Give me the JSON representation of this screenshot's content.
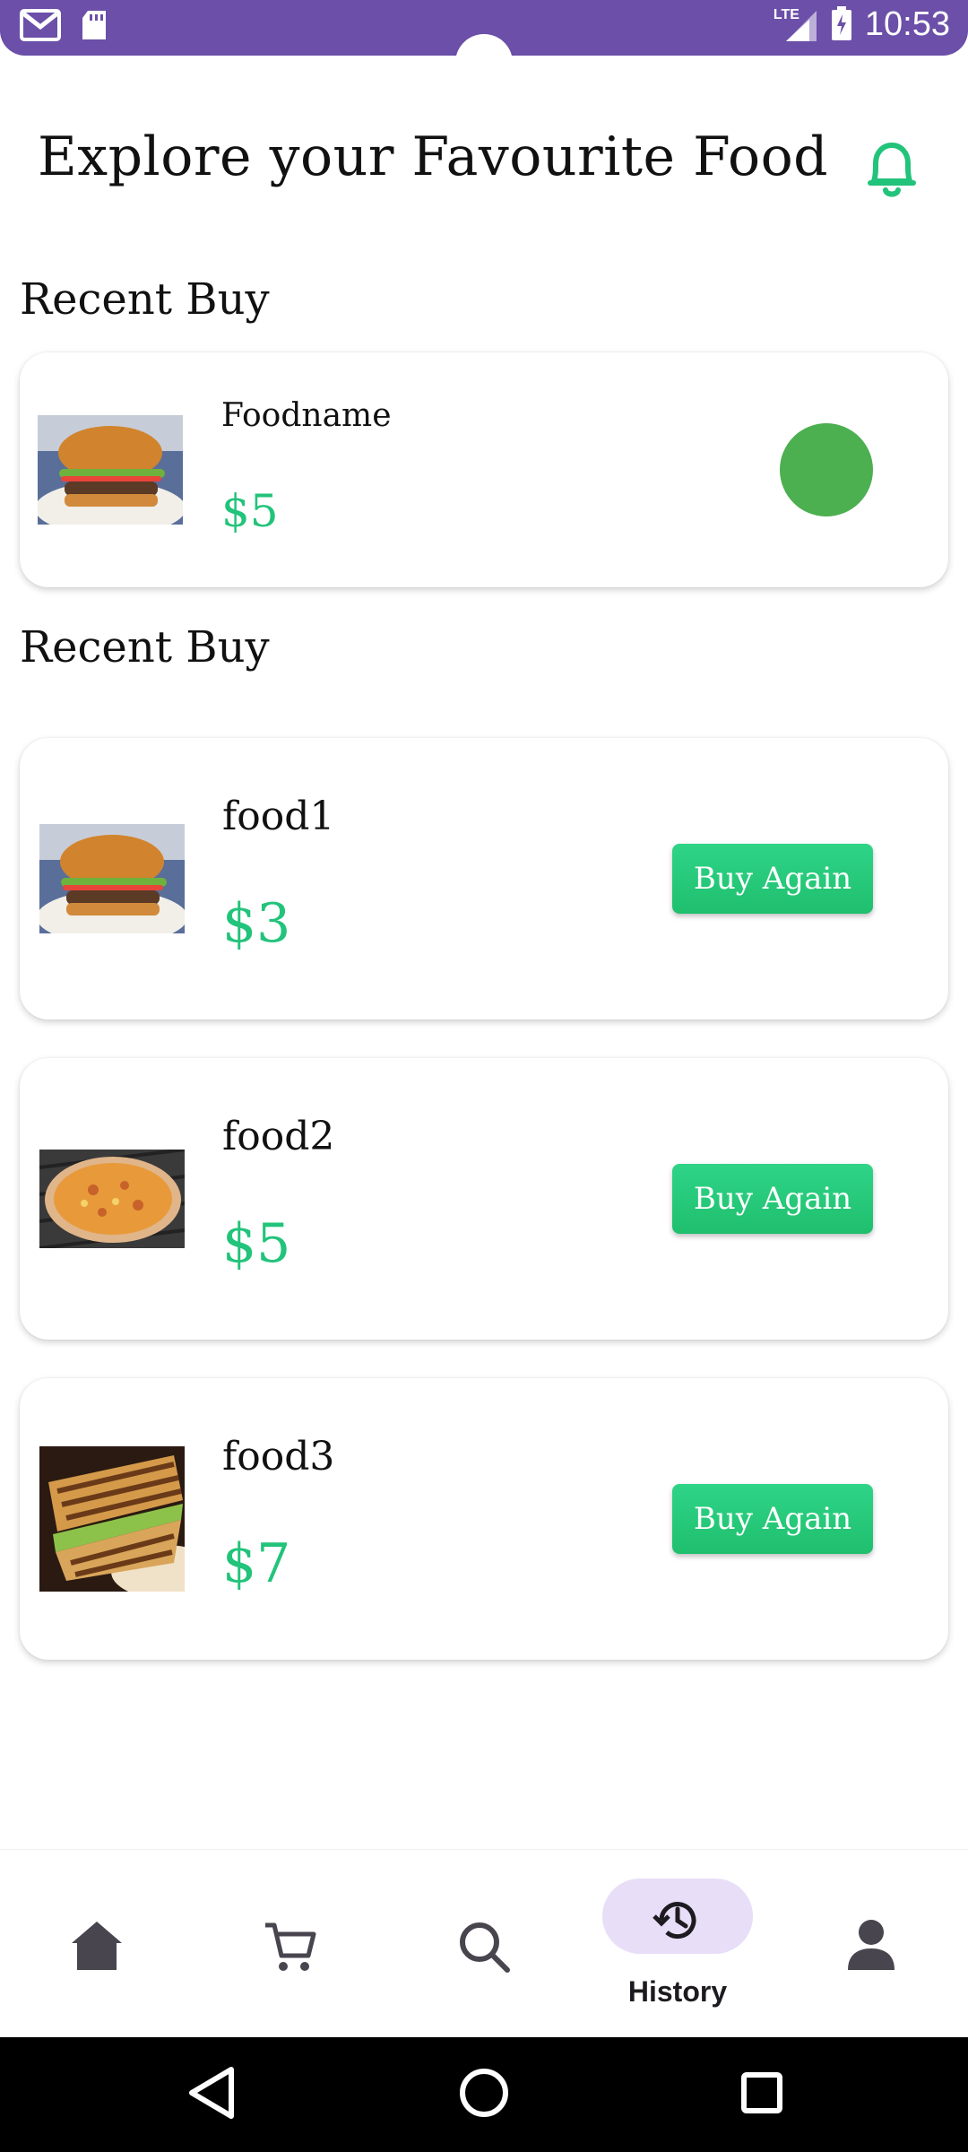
{
  "status_bar": {
    "time": "10:53",
    "network": "LTE",
    "icons": [
      "gmail-icon",
      "sd-card-icon",
      "signal-icon",
      "battery-charging-icon"
    ]
  },
  "header": {
    "title": "Explore your Favourite Food",
    "bell_icon": "bell-icon"
  },
  "recent_buy": {
    "label": "Recent Buy",
    "item": {
      "name": "Foodname",
      "price": "$5",
      "image": "burger"
    }
  },
  "history": {
    "label": "Recent Buy",
    "items": [
      {
        "name": "food1",
        "price": "$3",
        "button": "Buy Again",
        "image": "burger"
      },
      {
        "name": "food2",
        "price": "$5",
        "button": "Buy Again",
        "image": "pizza"
      },
      {
        "name": "food3",
        "price": "$7",
        "button": "Buy Again",
        "image": "sandwich"
      }
    ]
  },
  "bottom_nav": {
    "items": [
      {
        "icon": "home-icon",
        "label": ""
      },
      {
        "icon": "cart-icon",
        "label": ""
      },
      {
        "icon": "search-icon",
        "label": ""
      },
      {
        "icon": "history-icon",
        "label": "History",
        "active": true
      },
      {
        "icon": "profile-icon",
        "label": ""
      }
    ]
  },
  "colors": {
    "status_bar": "#6b4fa8",
    "accent_green": "#22c37a",
    "dot_green": "#4caf50",
    "nav_active_pill": "#e8def8"
  }
}
